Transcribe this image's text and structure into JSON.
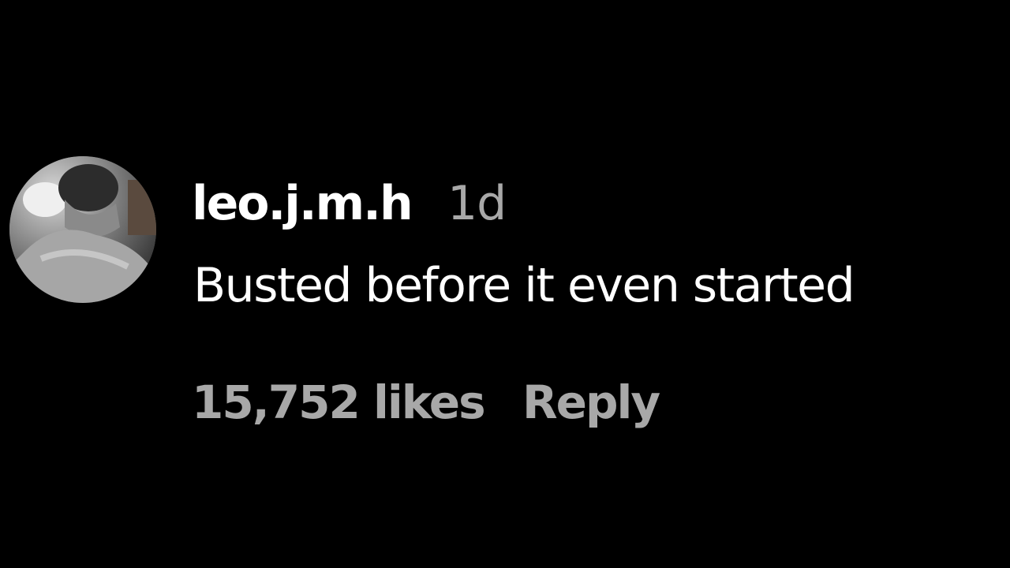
{
  "comment": {
    "username": "leo.j.m.h",
    "timestamp": "1d",
    "text": "Busted before it even started",
    "likes_label": "15,752 likes",
    "reply_label": "Reply"
  },
  "avatar": {
    "icon": "user-avatar-photo"
  },
  "colors": {
    "background": "#000000",
    "primary_text": "#ffffff",
    "secondary_text": "#a8a8a8"
  }
}
